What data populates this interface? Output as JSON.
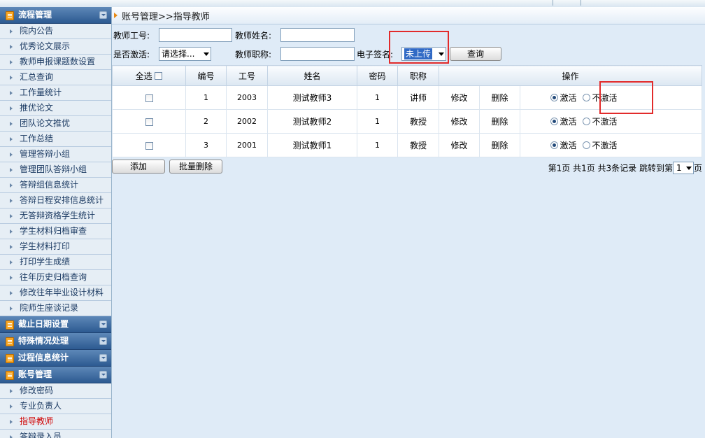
{
  "sidebar": {
    "groups": [
      {
        "title": "流程管理",
        "items": [
          "院内公告",
          "优秀论文展示",
          "教师申报课题数设置",
          "汇总查询",
          "工作量统计",
          "推优论文",
          "团队论文推优",
          "工作总结",
          "管理答辩小组",
          "管理团队答辩小组",
          "答辩组信息统计",
          "答辩日程安排信息统计",
          "无答辩资格学生统计",
          "学生材料归档审查",
          "学生材料打印",
          "打印学生成绩",
          "往年历史归档查询",
          "修改往年毕业设计材料",
          "院师生座谈记录"
        ]
      },
      {
        "title": "截止日期设置",
        "items": []
      },
      {
        "title": "特殊情况处理",
        "items": []
      },
      {
        "title": "过程信息统计",
        "items": []
      },
      {
        "title": "账号管理",
        "items": [
          "修改密码",
          "专业负责人",
          "指导教师",
          "答辩录入员"
        ]
      }
    ],
    "active_item": "指导教师"
  },
  "breadcrumb": "账号管理>>指导教师",
  "filters": {
    "teacher_id_label": "教师工号:",
    "teacher_id_value": "",
    "teacher_name_label": "教师姓名:",
    "teacher_name_value": "",
    "activated_label": "是否激活:",
    "activated_value": "请选择...",
    "title_label": "教师职称:",
    "title_value": "",
    "signature_label": "电子签名:",
    "signature_value": "未上传",
    "query_button": "查询"
  },
  "table": {
    "headers": {
      "select_all": "全选",
      "number": "编号",
      "work_id": "工号",
      "name": "姓名",
      "password": "密码",
      "title": "职称",
      "actions": "操作"
    },
    "rows": [
      {
        "number": "1",
        "work_id": "2003",
        "name": "测试教师3",
        "password": "1",
        "title": "讲师",
        "edit": "修改",
        "delete": "删除",
        "active_label": "激活",
        "inactive_label": "不激活",
        "active": true
      },
      {
        "number": "2",
        "work_id": "2002",
        "name": "测试教师2",
        "password": "1",
        "title": "教授",
        "edit": "修改",
        "delete": "删除",
        "active_label": "激活",
        "inactive_label": "不激活",
        "active": true
      },
      {
        "number": "3",
        "work_id": "2001",
        "name": "测试教师1",
        "password": "1",
        "title": "教授",
        "edit": "修改",
        "delete": "删除",
        "active_label": "激活",
        "inactive_label": "不激活",
        "active": true
      }
    ]
  },
  "bottom": {
    "add_button": "添加",
    "batch_delete_button": "批量删除"
  },
  "pager": {
    "page_info": "第1页 共1页 共3条记录 跳转到第",
    "page_value": "1",
    "suffix": "页"
  }
}
